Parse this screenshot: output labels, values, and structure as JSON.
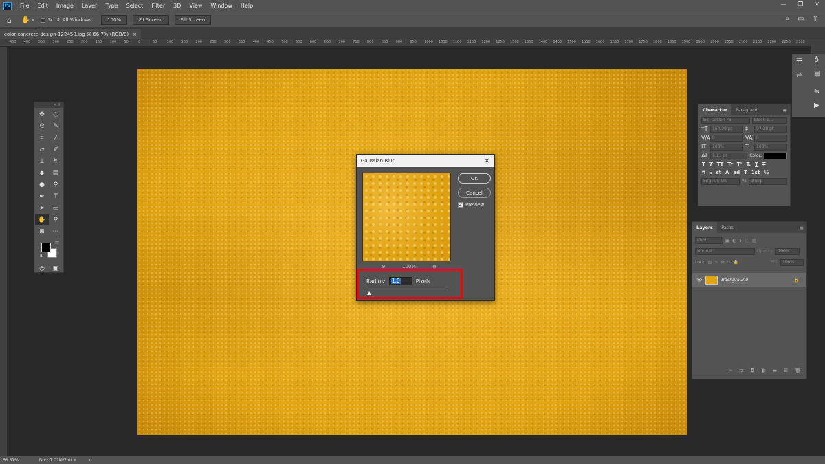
{
  "app": {
    "logo": "Ps"
  },
  "menubar": {
    "items": [
      "File",
      "Edit",
      "Image",
      "Layer",
      "Type",
      "Select",
      "Filter",
      "3D",
      "View",
      "Window",
      "Help"
    ]
  },
  "window_controls": [
    "—",
    "❐",
    "✕"
  ],
  "options_bar": {
    "scroll_all_label": "Scroll All Windows",
    "zoom_btn": "100%",
    "fit_btn": "Fit Screen",
    "fill_btn": "Fill Screen"
  },
  "document_tab": {
    "title": "color-concrete-design-122458.jpg @ 66.7% (RGB/8)",
    "close": "×"
  },
  "ruler_ticks": [
    "450",
    "400",
    "350",
    "300",
    "250",
    "200",
    "150",
    "100",
    "50",
    "0",
    "50",
    "100",
    "150",
    "200",
    "250",
    "300",
    "350",
    "400",
    "450",
    "500",
    "550",
    "600",
    "650",
    "700",
    "750",
    "800",
    "850",
    "900",
    "950",
    "1000",
    "1050",
    "1100",
    "1150",
    "1200",
    "1250",
    "1300",
    "1350",
    "1400",
    "1450",
    "1500",
    "1550",
    "1600",
    "1650",
    "1700",
    "1750",
    "1800",
    "1850",
    "1900",
    "1950",
    "2000",
    "2050",
    "2100",
    "2150",
    "2200",
    "2250",
    "2300"
  ],
  "character_panel": {
    "tabs": [
      "Character",
      "Paragraph"
    ],
    "font_family": "Big Caslon FB",
    "font_style": "Black 1...",
    "font_size": "154.29 pt",
    "leading": "97.38 pt",
    "kerning": "0",
    "tracking": "0",
    "vscale": "100%",
    "hscale": "100%",
    "baseline": "1.11 pt",
    "color_label": "Color:",
    "color_value": "#000000",
    "style_row1": [
      "T",
      "T",
      "TT",
      "Tr",
      "T¹",
      "T,",
      "T",
      "T"
    ],
    "style_row2": [
      "fi",
      "ℴ",
      "st",
      "A",
      "ad",
      "T",
      "1st",
      "½"
    ],
    "language": "English: UK",
    "antialias": "Sharp"
  },
  "layers_panel": {
    "tabs": [
      "Layers",
      "Paths"
    ],
    "kind_label": "Kind",
    "blend_mode": "Normal",
    "opacity_label": "Opacity:",
    "opacity_value": "100%",
    "lock_label": "Lock:",
    "fill_label": "Fill:",
    "fill_value": "100%",
    "layer_name": "Background"
  },
  "dialog": {
    "title": "Gaussian Blur",
    "ok": "OK",
    "cancel": "Cancel",
    "preview_label": "Preview",
    "zoom_level": "100%",
    "radius_label": "Radius:",
    "radius_value": "1.0",
    "unit": "Pixels"
  },
  "statusbar": {
    "zoom": "66.67%",
    "doc": "Doc: 7.01M/7.01M",
    "arrow": "›"
  },
  "colors": {
    "canvas": "#e0a414",
    "highlight": "#ff0000",
    "foreground": "#000000",
    "background": "#ffffff"
  }
}
